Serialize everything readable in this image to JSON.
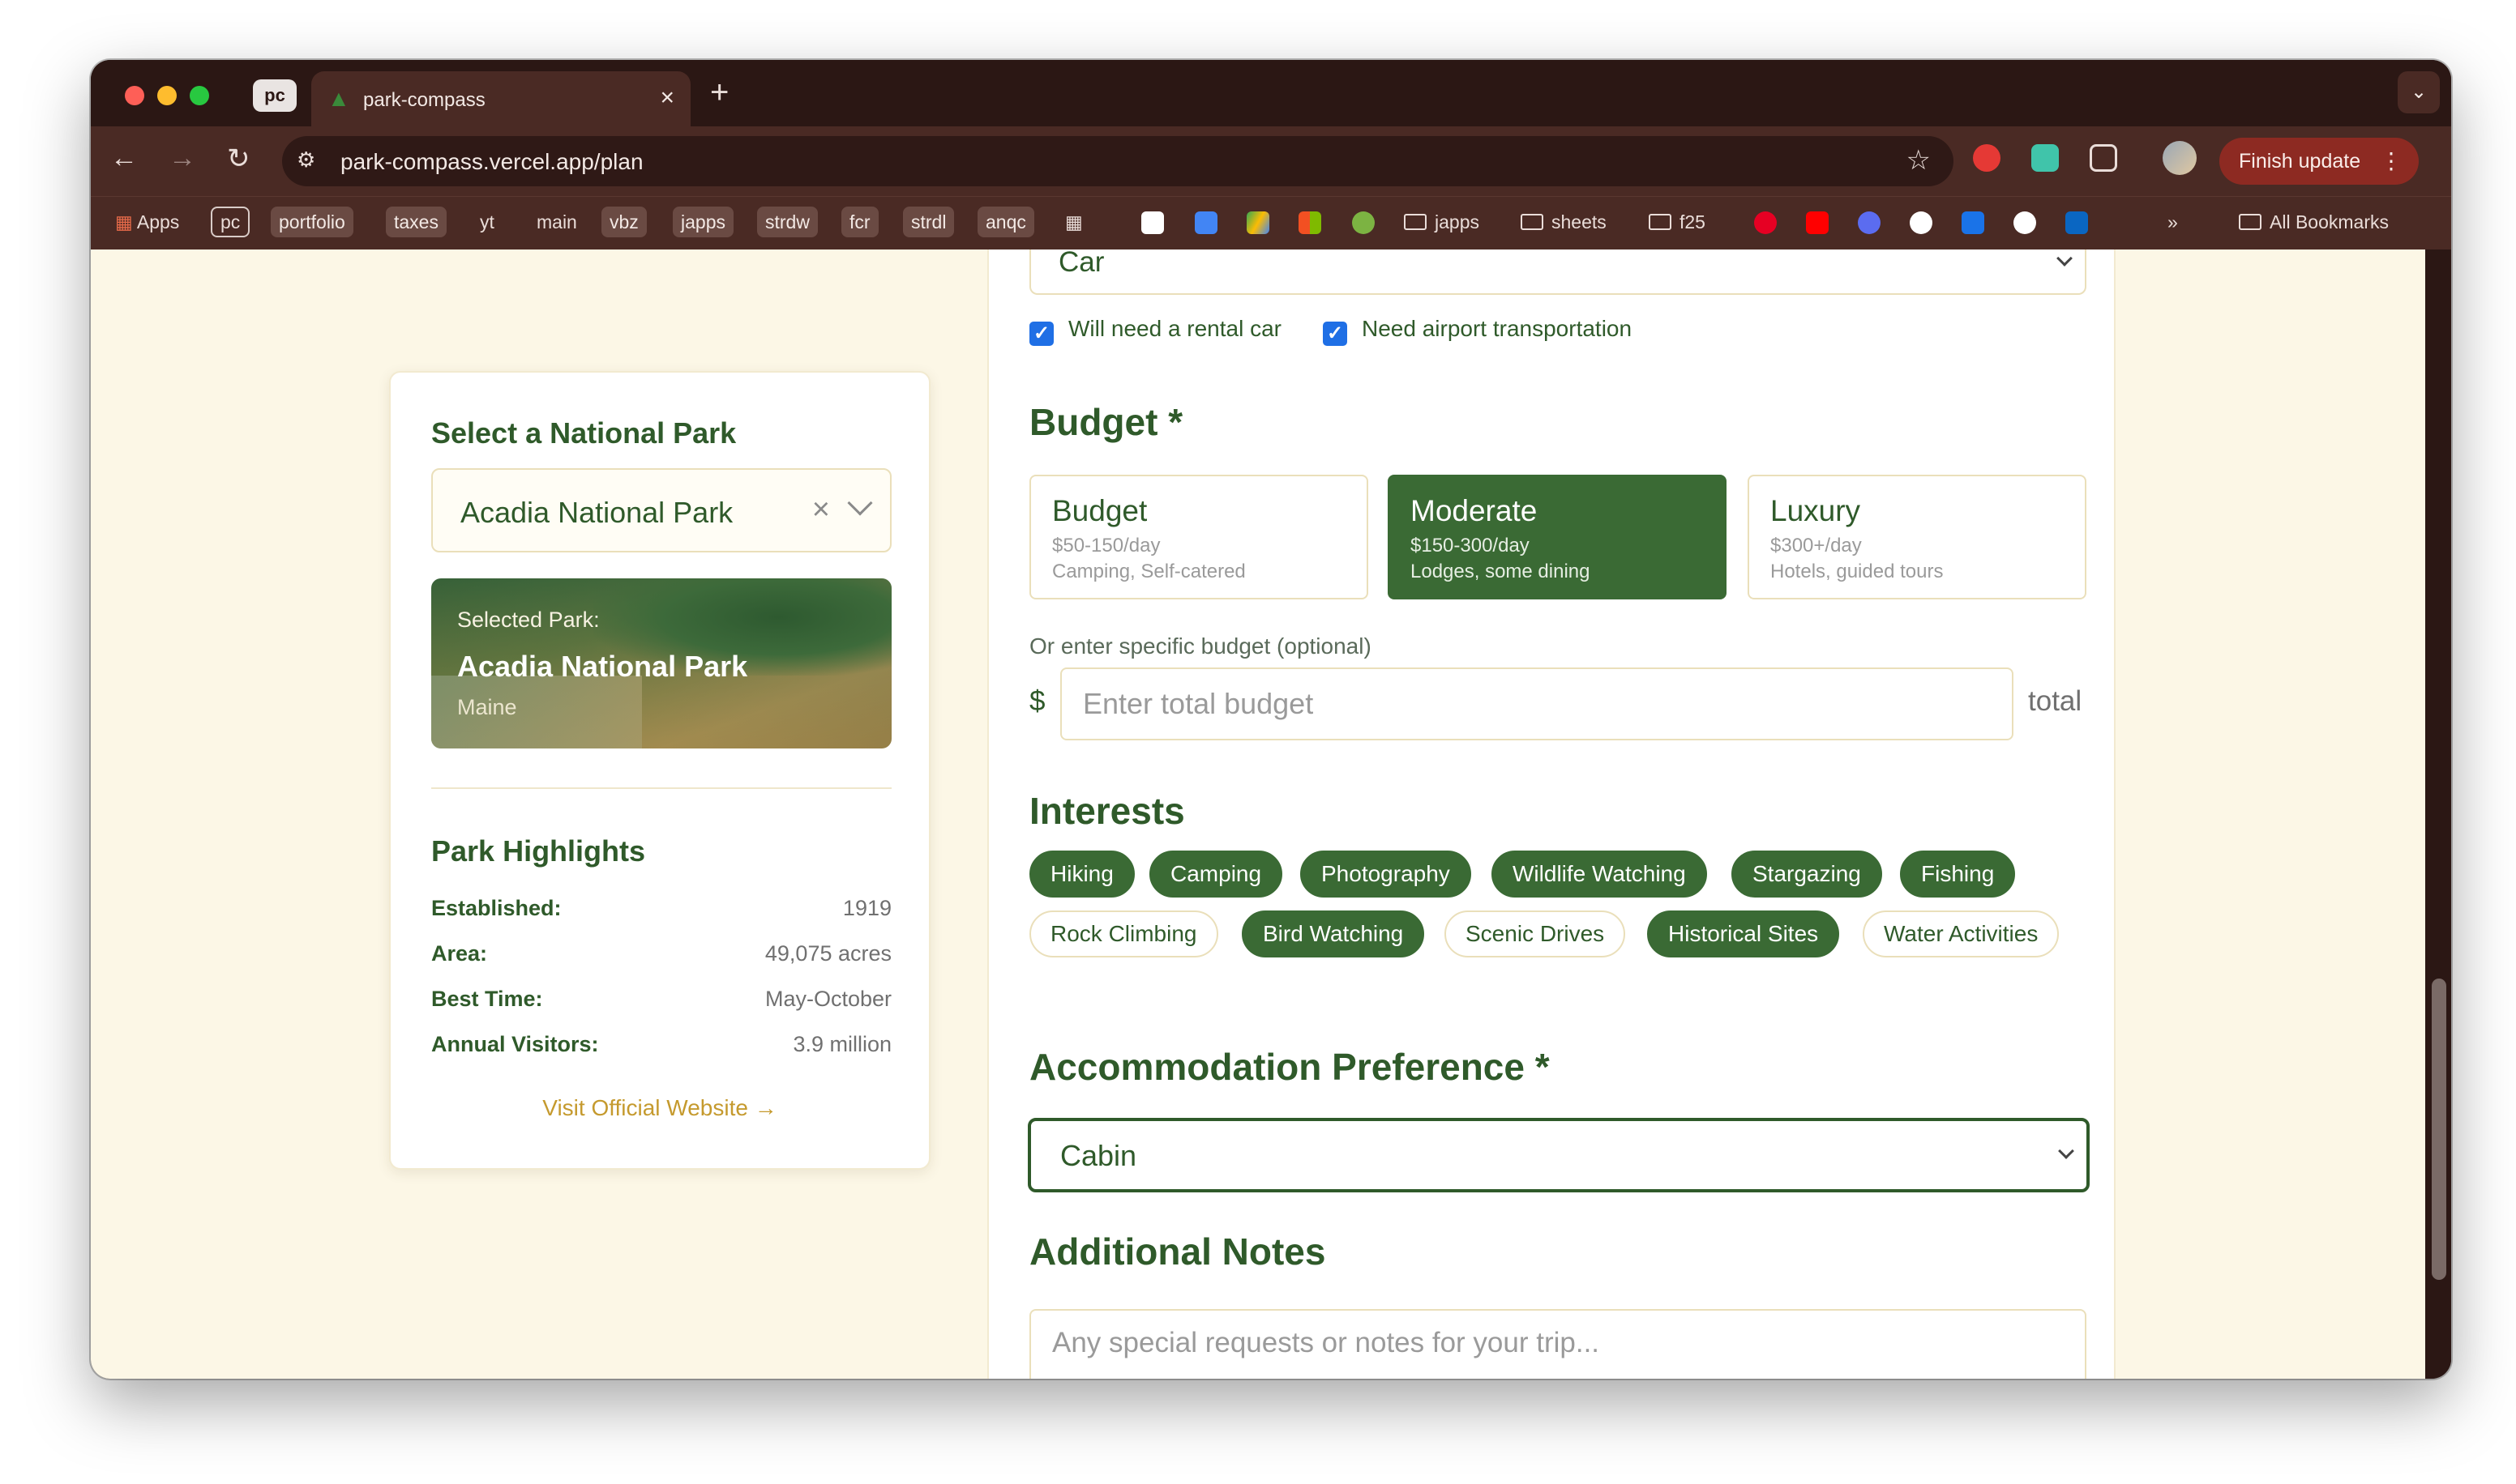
{
  "browser": {
    "profile_chip": "pc",
    "tab_title": "park-compass",
    "url": "park-compass.vercel.app/plan",
    "finish_update": "Finish update",
    "colors": {
      "chrome": "#2b1714",
      "toolbar": "#4a2a24",
      "update": "#8d2a22"
    }
  },
  "bookmarks": {
    "apps": "Apps",
    "items": [
      "pc",
      "portfolio",
      "taxes",
      "yt",
      "main",
      "vbz",
      "japps",
      "strdw",
      "fcr",
      "strdl",
      "anqc"
    ],
    "folders": [
      "japps",
      "sheets",
      "f25"
    ],
    "overflow": "»",
    "all_bookmarks": "All Bookmarks"
  },
  "sidebar": {
    "select_heading": "Select a National Park",
    "selected_park_value": "Acadia National Park",
    "image_caption": "Selected Park:",
    "image_park_name": "Acadia National Park",
    "image_state": "Maine",
    "highlights_heading": "Park Highlights",
    "highlights": [
      {
        "label": "Established:",
        "value": "1919"
      },
      {
        "label": "Area:",
        "value": "49,075 acres"
      },
      {
        "label": "Best Time:",
        "value": "May-October"
      },
      {
        "label": "Annual Visitors:",
        "value": "3.9 million"
      }
    ],
    "visit_link": "Visit Official Website →"
  },
  "form": {
    "transportation_value": "Car",
    "rental_car_label": "Will need a rental car",
    "airport_label": "Need airport transportation",
    "budget_heading": "Budget *",
    "budget_options": [
      {
        "name": "Budget",
        "price": "$50-150/day",
        "desc": "Camping, Self-catered",
        "selected": false
      },
      {
        "name": "Moderate",
        "price": "$150-300/day",
        "desc": "Lodges, some dining",
        "selected": true
      },
      {
        "name": "Luxury",
        "price": "$300+/day",
        "desc": "Hotels, guided tours",
        "selected": false
      }
    ],
    "specific_budget_label": "Or enter specific budget (optional)",
    "currency_symbol": "$",
    "budget_placeholder": "Enter total budget",
    "total_label": "total",
    "interests_heading": "Interests",
    "interests": [
      {
        "label": "Hiking",
        "selected": true
      },
      {
        "label": "Camping",
        "selected": true
      },
      {
        "label": "Photography",
        "selected": true
      },
      {
        "label": "Wildlife Watching",
        "selected": true
      },
      {
        "label": "Stargazing",
        "selected": true
      },
      {
        "label": "Fishing",
        "selected": true
      },
      {
        "label": "Rock Climbing",
        "selected": false
      },
      {
        "label": "Bird Watching",
        "selected": true
      },
      {
        "label": "Scenic Drives",
        "selected": false
      },
      {
        "label": "Historical Sites",
        "selected": true
      },
      {
        "label": "Water Activities",
        "selected": false
      }
    ],
    "accommodation_heading": "Accommodation Preference *",
    "accommodation_value": "Cabin",
    "notes_heading": "Additional Notes",
    "notes_placeholder": "Any special requests or notes for your trip...",
    "colors": {
      "primary": "#3a6a34",
      "accent": "#c59a2e",
      "background": "#fcf7e6"
    }
  }
}
